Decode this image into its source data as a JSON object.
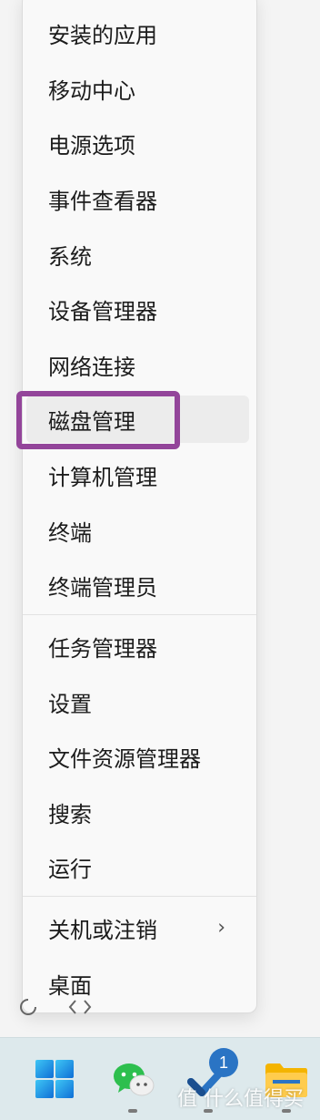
{
  "menu": {
    "items": [
      {
        "label": "安装的应用"
      },
      {
        "label": "移动中心"
      },
      {
        "label": "电源选项"
      },
      {
        "label": "事件查看器"
      },
      {
        "label": "系统"
      },
      {
        "label": "设备管理器"
      },
      {
        "label": "网络连接"
      },
      {
        "label": "磁盘管理"
      },
      {
        "label": "计算机管理"
      },
      {
        "label": "终端"
      },
      {
        "label": "终端管理员"
      },
      {
        "label": "任务管理器"
      },
      {
        "label": "设置"
      },
      {
        "label": "文件资源管理器"
      },
      {
        "label": "搜索"
      },
      {
        "label": "运行"
      },
      {
        "label": "关机或注销"
      },
      {
        "label": "桌面"
      }
    ],
    "highlighted_item": "磁盘管理",
    "submenu_arrow": "›"
  },
  "taskbar": {
    "apps": [
      {
        "icon": "windows-start-icon"
      },
      {
        "icon": "wechat-icon"
      },
      {
        "icon": "todo-check-icon"
      },
      {
        "icon": "file-explorer-icon"
      }
    ],
    "badge_count": "1"
  },
  "watermark": "值 什么值得买",
  "colors": {
    "highlight": "#93459a",
    "taskbar": "#dde9ec",
    "menu_bg": "#f9f9f9",
    "badge": "#2a74c4"
  }
}
